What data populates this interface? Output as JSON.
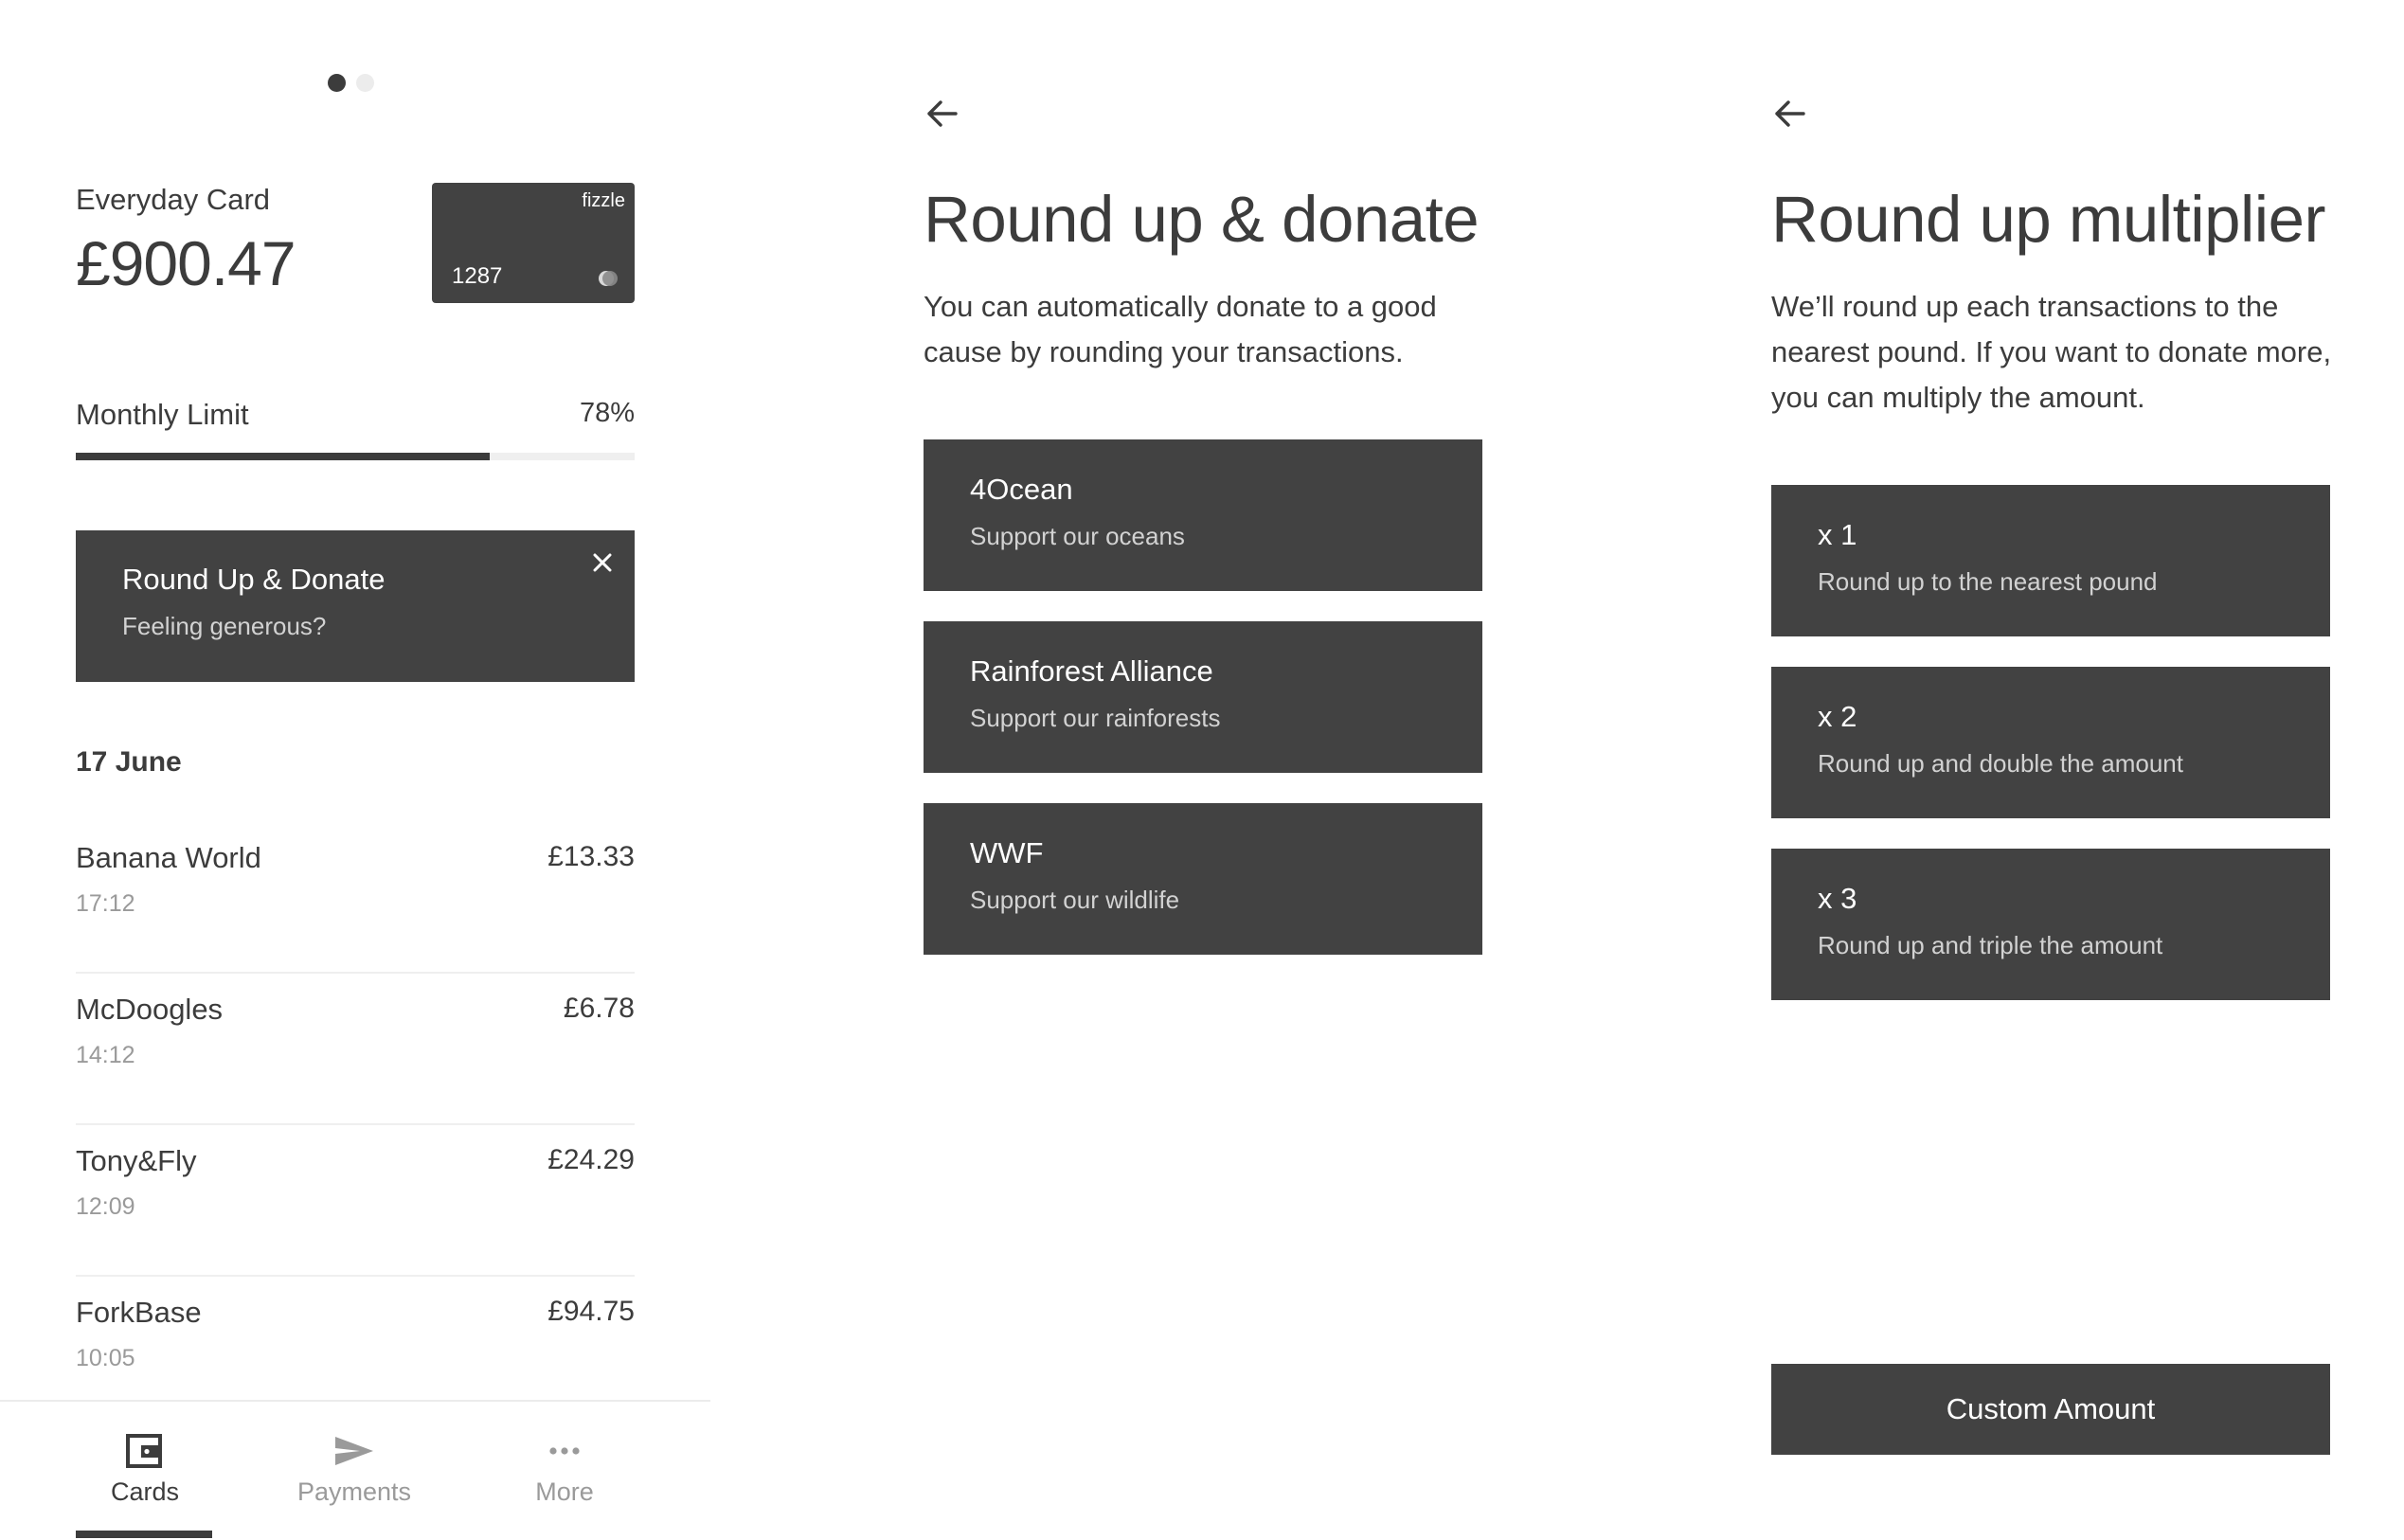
{
  "cards_screen": {
    "pager": {
      "total": 2,
      "active": 0
    },
    "card": {
      "name": "Everyday Card",
      "balance": "£900.47",
      "brand": "fizzle",
      "last4": "1287"
    },
    "monthly_limit": {
      "label": "Monthly Limit",
      "percent_text": "78%",
      "fraction": 0.74
    },
    "promo": {
      "title": "Round Up & Donate",
      "subtitle": "Feeling generous?"
    },
    "date_header": "17 June",
    "transactions": [
      {
        "merchant": "Banana World",
        "time": "17:12",
        "amount": "£13.33"
      },
      {
        "merchant": "McDoogles",
        "time": "14:12",
        "amount": "£6.78"
      },
      {
        "merchant": "Tony&Fly",
        "time": "12:09",
        "amount": "£24.29"
      },
      {
        "merchant": "ForkBase",
        "time": "10:05",
        "amount": "£94.75"
      }
    ],
    "tabs": [
      {
        "label": "Cards",
        "icon": "wallet-icon",
        "active": true
      },
      {
        "label": "Payments",
        "icon": "send-icon",
        "active": false
      },
      {
        "label": "More",
        "icon": "more-icon",
        "active": false
      }
    ]
  },
  "donate_screen": {
    "title": "Round up & donate",
    "description": "You can automatically donate to a good cause by rounding your transactions.",
    "charities": [
      {
        "name": "4Ocean",
        "tagline": "Support our oceans"
      },
      {
        "name": "Rainforest Alliance",
        "tagline": "Support our rainforests"
      },
      {
        "name": "WWF",
        "tagline": "Support our wildlife"
      }
    ]
  },
  "multiplier_screen": {
    "title": "Round up multiplier",
    "description": "We’ll round up each transactions to the nearest pound. If you want to donate more, you can multiply the amount.",
    "options": [
      {
        "label": "x 1",
        "description": "Round up to the nearest pound"
      },
      {
        "label": "x 2",
        "description": "Round up and double the amount"
      },
      {
        "label": "x 3",
        "description": "Round up and triple the amount"
      }
    ],
    "custom_button": "Custom Amount"
  },
  "colors": {
    "dark": "#424242",
    "text": "#3c3c3c",
    "muted": "#9a9a9a",
    "track": "#efefef"
  }
}
